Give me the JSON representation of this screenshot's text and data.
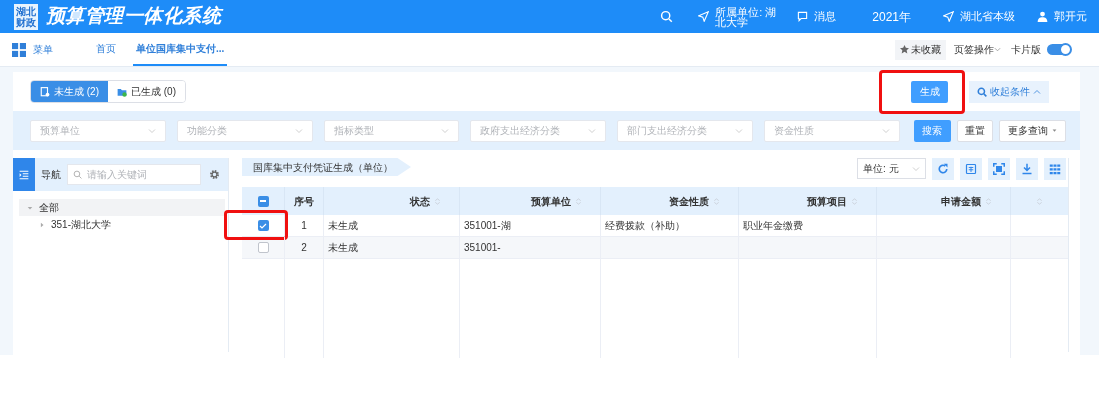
{
  "header": {
    "logo_text": "湖北财政",
    "title": "预算管理一体化系统",
    "unit": "所属单位: 湖北大学",
    "messages": "消息",
    "year": "2021年",
    "region": "湖北省本级",
    "user": "郭开元"
  },
  "nav": {
    "menu": "菜单",
    "tabs": [
      {
        "label": "首页",
        "selected": false
      },
      {
        "label": "单位国库集中支付...",
        "selected": true
      }
    ],
    "favorite": "未收藏",
    "tab_ops": "页签操作",
    "card_mode": "卡片版",
    "card_mode_on": true
  },
  "status_tabs": [
    {
      "label": "未生成 (2)",
      "selected": true
    },
    {
      "label": "已生成 (0)",
      "selected": false
    }
  ],
  "generate_button": {
    "label": "生成",
    "annotated": true
  },
  "collapse_button": "收起条件",
  "filters": [
    {
      "placeholder": "预算单位"
    },
    {
      "placeholder": "功能分类"
    },
    {
      "placeholder": "指标类型"
    },
    {
      "placeholder": "政府支出经济分类"
    },
    {
      "placeholder": "部门支出经济分类"
    },
    {
      "placeholder": "资金性质"
    }
  ],
  "filter_buttons": {
    "search": "搜索",
    "reset": "重置",
    "more": "更多查询"
  },
  "sidebar": {
    "title": "导航",
    "search_placeholder": "请输入关键词",
    "tree": [
      {
        "label": "全部",
        "expanded": true,
        "children": [
          {
            "label": "351-湖北大学",
            "expanded": false
          }
        ]
      }
    ]
  },
  "table": {
    "title": "国库集中支付凭证生成（单位）",
    "unit_select": "单位: 元",
    "select_all_indeterminate": true,
    "columns": [
      "序号",
      "状态",
      "预算单位",
      "资金性质",
      "预算项目",
      "申请金额"
    ],
    "rows": [
      {
        "checked": true,
        "annotated": true,
        "cells": [
          "1",
          "未生成",
          "351001-湖",
          "经费拨款（补助）",
          "职业年金缴费",
          ""
        ]
      },
      {
        "checked": false,
        "annotated": false,
        "cells": [
          "2",
          "未生成",
          "351001-",
          "",
          "",
          ""
        ]
      }
    ]
  }
}
